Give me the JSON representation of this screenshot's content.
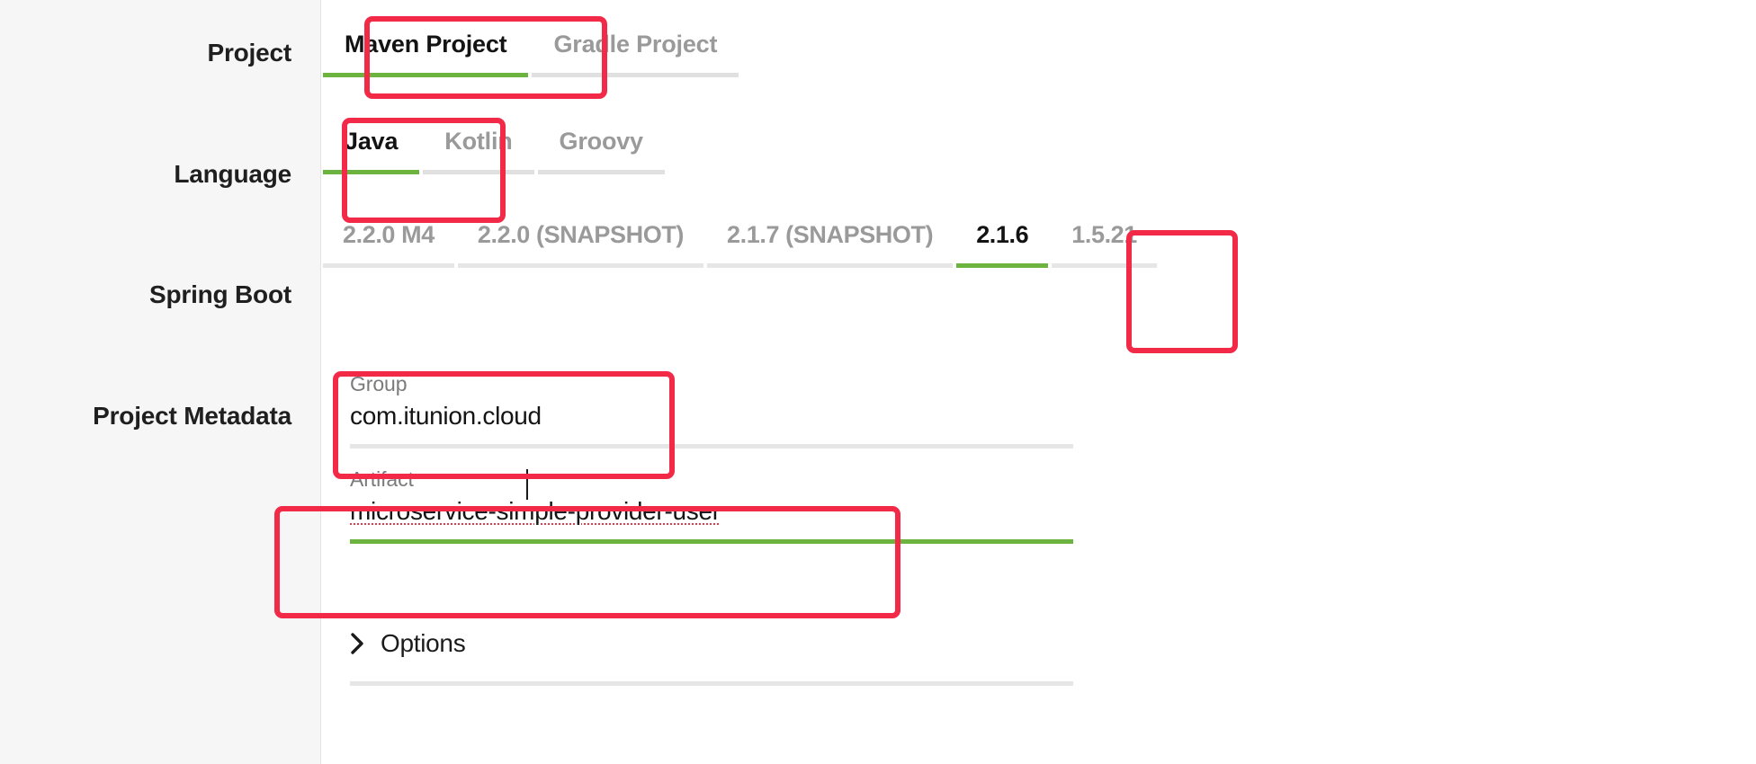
{
  "form": {
    "rows": [
      {
        "label": "Project"
      },
      {
        "label": "Language"
      },
      {
        "label": "Spring Boot"
      },
      {
        "label": "Project Metadata"
      }
    ]
  },
  "project": {
    "label": "Project",
    "options": [
      {
        "label": "Maven Project",
        "selected": true
      },
      {
        "label": "Gradle Project",
        "selected": false
      }
    ]
  },
  "language": {
    "label": "Language",
    "options": [
      {
        "label": "Java",
        "selected": true
      },
      {
        "label": "Kotlin",
        "selected": false
      },
      {
        "label": "Groovy",
        "selected": false
      }
    ]
  },
  "spring_boot": {
    "label": "Spring Boot",
    "versions": [
      {
        "label": "2.2.0 M4",
        "selected": false
      },
      {
        "label": "2.2.0 (SNAPSHOT)",
        "selected": false
      },
      {
        "label": "2.1.7 (SNAPSHOT)",
        "selected": false
      },
      {
        "label": "2.1.6",
        "selected": true
      },
      {
        "label": "1.5.21",
        "selected": false
      }
    ]
  },
  "metadata": {
    "label": "Project Metadata",
    "group": {
      "caption": "Group",
      "value": "com.itunion.cloud"
    },
    "artifact": {
      "caption": "Artifact",
      "value": "microservice-simple-provider-user"
    }
  },
  "options": {
    "label": "Options",
    "icon": "chevron-right-icon",
    "expanded": false
  },
  "colors": {
    "accent_green": "#6db33f",
    "annotation_red": "#f22a48",
    "track_gray": "#e6e6e6",
    "sidebar_bg": "#f6f6f6",
    "text_dark": "#141414",
    "text_muted": "#9a9a9a"
  }
}
